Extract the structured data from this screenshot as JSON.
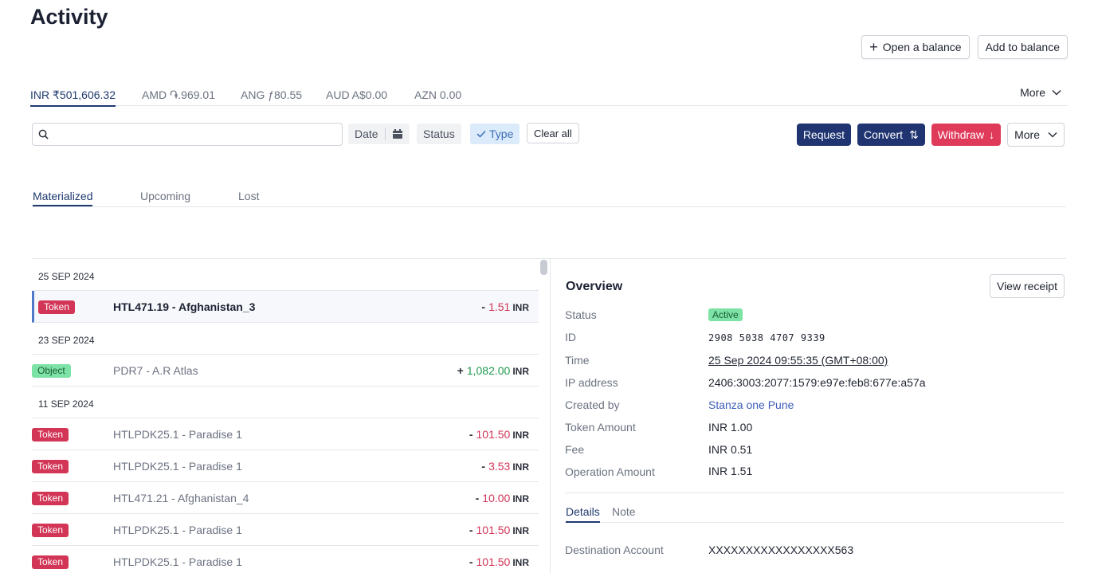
{
  "page_title": "Activity",
  "top_actions": {
    "open_balance": "Open a balance",
    "add_balance": "Add to balance"
  },
  "currency_tabs": [
    {
      "label": "INR ₹501,606.32"
    },
    {
      "label": "AMD ֏.969.01"
    },
    {
      "label": "ANG ƒ80.55"
    },
    {
      "label": "AUD A$0.00"
    },
    {
      "label": "AZN 0.00"
    }
  ],
  "currency_more": "More",
  "filters": {
    "search_placeholder": "",
    "date": "Date",
    "status": "Status",
    "type": "Type",
    "clear_all": "Clear all"
  },
  "actions": {
    "request": "Request",
    "convert": "Convert",
    "convert_icon": "⇅",
    "withdraw": "Withdraw",
    "withdraw_icon": "↓",
    "more": "More"
  },
  "status_tabs": [
    "Materialized",
    "Upcoming",
    "Lost"
  ],
  "groups": [
    {
      "date": "25 SEP 2024",
      "items": [
        {
          "badge": "Token",
          "desc": "HTL471.19 - Afghanistan_3",
          "sign": "-",
          "amount": "1.51",
          "currency": "INR"
        }
      ]
    },
    {
      "date": "23 SEP 2024",
      "items": [
        {
          "badge": "Object",
          "desc": "PDR7 - A.R Atlas",
          "sign": "+",
          "amount": "1,082.00",
          "currency": "INR"
        }
      ]
    },
    {
      "date": "11 SEP 2024",
      "items": [
        {
          "badge": "Token",
          "desc": "HTLPDK25.1 - Paradise 1",
          "sign": "-",
          "amount": "101.50",
          "currency": "INR"
        },
        {
          "badge": "Token",
          "desc": "HTLPDK25.1 - Paradise 1",
          "sign": "-",
          "amount": "3.53",
          "currency": "INR"
        },
        {
          "badge": "Token",
          "desc": "HTL471.21 - Afghanistan_4",
          "sign": "-",
          "amount": "10.00",
          "currency": "INR"
        },
        {
          "badge": "Token",
          "desc": "HTLPDK25.1 - Paradise 1",
          "sign": "-",
          "amount": "101.50",
          "currency": "INR"
        },
        {
          "badge": "Token",
          "desc": "HTLPDK25.1 - Paradise 1",
          "sign": "-",
          "amount": "101.50",
          "currency": "INR"
        }
      ]
    }
  ],
  "overview": {
    "title": "Overview",
    "view_receipt": "View receipt",
    "fields": {
      "status_label": "Status",
      "status_value": "Active",
      "id_label": "ID",
      "id_value": "2908 5038 4707 9339",
      "time_label": "Time",
      "time_value": "25 Sep 2024 09:55:35 (GMT+08:00)",
      "ip_label": "IP address",
      "ip_value": "2406:3003:2077:1579:e97e:feb8:677e:a57a",
      "created_label": "Created by",
      "created_value": "Stanza one Pune",
      "token_label": "Token Amount",
      "token_value": "INR 1.00",
      "fee_label": "Fee",
      "fee_value": "INR 0.51",
      "op_label": "Operation Amount",
      "op_value": "INR 1.51"
    },
    "tabs": [
      "Details",
      "Note"
    ],
    "destination_label": "Destination Account",
    "destination_value": "XXXXXXXXXXXXXXXXX563"
  },
  "colors": {
    "navy": "#1f3470",
    "red": "#e03a5a",
    "token_badge": "#d23556",
    "object_badge": "#7de2a5",
    "positive": "#1f9a4f",
    "negative": "#d23556"
  }
}
